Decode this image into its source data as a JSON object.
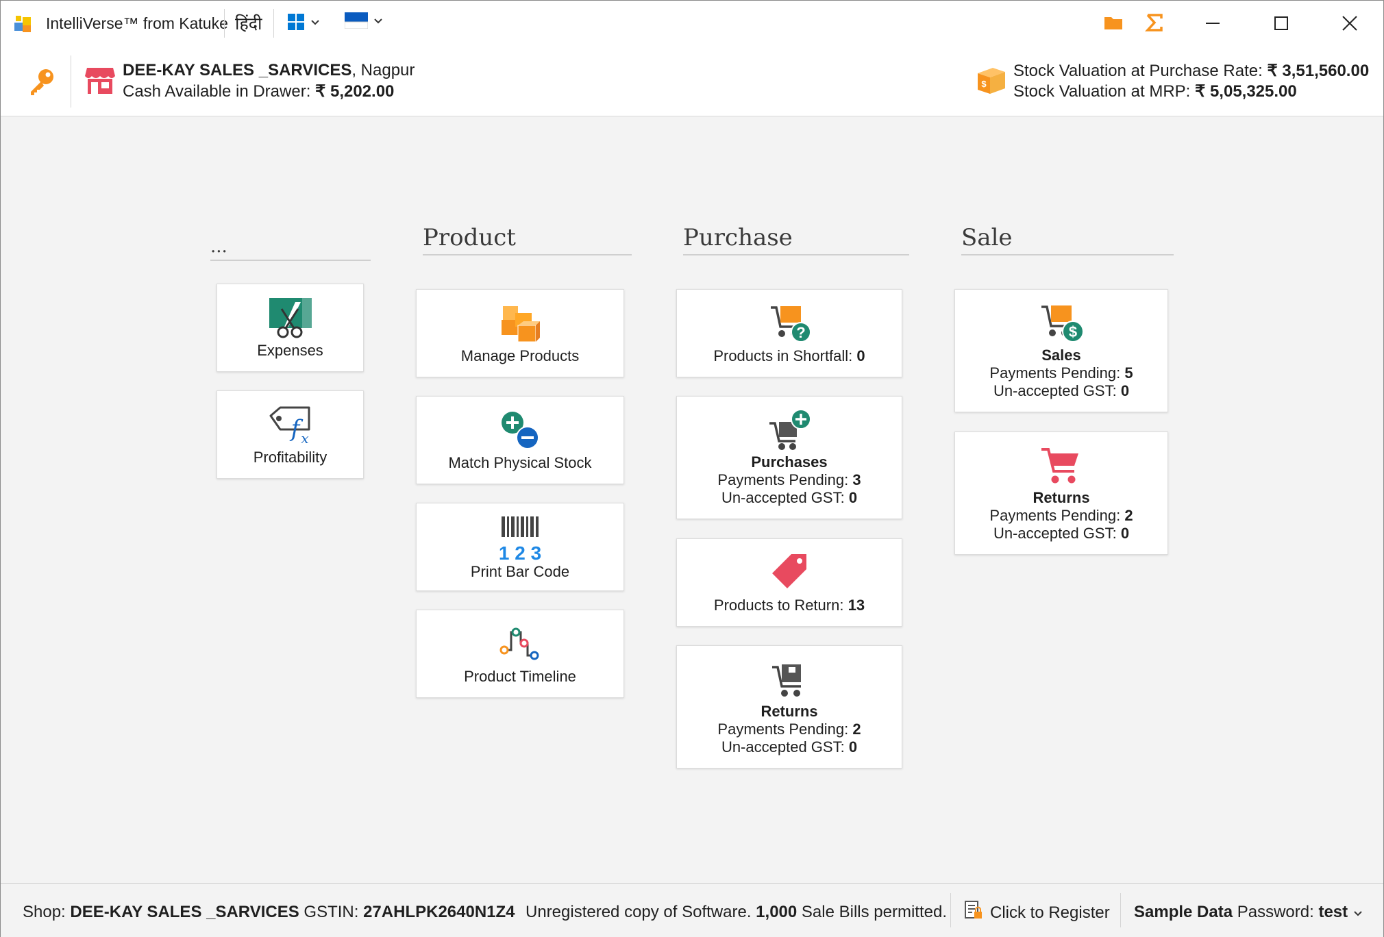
{
  "titlebar": {
    "app_title": "IntelliVerse™ from Katuke",
    "language": "हिंदी",
    "icons": [
      "app-icon",
      "windows-layout-icon",
      "flag-icon",
      "folder-icon",
      "sigma-icon",
      "minimize-icon",
      "maximize-icon",
      "close-icon"
    ],
    "colors": {
      "accent_orange": "#f7931e",
      "windows_blue": "#0078d4"
    }
  },
  "infobar": {
    "shop_name": "DEE-KAY SALES _SARVICES",
    "shop_city": ", Nagpur",
    "cash_label": "Cash Available in Drawer: ",
    "cash_value": "₹ 5,202.00",
    "stock_purchase_label": "Stock Valuation at Purchase Rate: ",
    "stock_purchase_value": "₹ 3,51,560.00",
    "stock_mrp_label": "Stock Valuation at MRP: ",
    "stock_mrp_value": "₹ 5,05,325.00"
  },
  "sections": {
    "misc": {
      "title": "...",
      "expenses": "Expenses",
      "profitability": "Profitability"
    },
    "product": {
      "title": "Product",
      "manage": "Manage Products",
      "match": "Match Physical Stock",
      "barcode": "Print Bar Code",
      "barcode_digits": "1 2 3",
      "timeline": "Product Timeline"
    },
    "purchase": {
      "title": "Purchase",
      "shortfall_label": "Products in Shortfall: ",
      "shortfall_value": "0",
      "purchases_title": "Purchases",
      "purchases_pending_label": "Payments Pending: ",
      "purchases_pending_value": "3",
      "purchases_gst_label": "Un-accepted GST: ",
      "purchases_gst_value": "0",
      "to_return_label": "Products to Return: ",
      "to_return_value": "13",
      "returns_title": "Returns",
      "returns_pending_label": "Payments Pending: ",
      "returns_pending_value": "2",
      "returns_gst_label": "Un-accepted GST: ",
      "returns_gst_value": "0"
    },
    "sale": {
      "title": "Sale",
      "sales_title": "Sales",
      "sales_pending_label": "Payments Pending: ",
      "sales_pending_value": "5",
      "sales_gst_label": "Un-accepted GST: ",
      "sales_gst_value": "0",
      "returns_title": "Returns",
      "returns_pending_label": "Payments Pending: ",
      "returns_pending_value": "2",
      "returns_gst_label": "Un-accepted GST: ",
      "returns_gst_value": "0"
    }
  },
  "statusbar": {
    "shop_label": "Shop: ",
    "shop_name": "DEE-KAY SALES _SARVICES",
    "gstin_label": " GSTIN: ",
    "gstin_value": "27AHLPK2640N1Z4",
    "unreg_text": "Unregistered copy of Software. ",
    "bills_count": "1,000",
    "bills_text": " Sale Bills permitted.",
    "register_label": "Click to Register",
    "sample_label": "Sample Data",
    "password_label": " Password: ",
    "password_value": "test"
  }
}
